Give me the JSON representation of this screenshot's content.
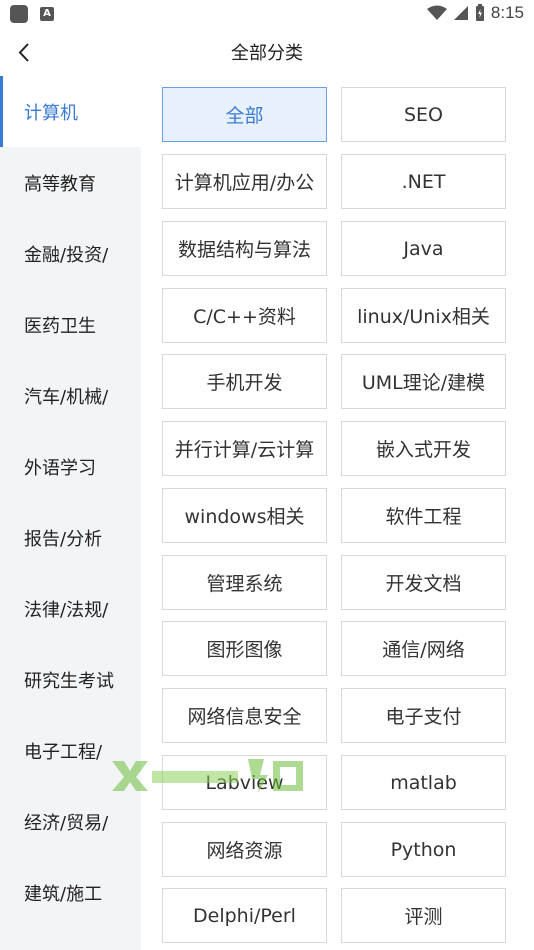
{
  "status": {
    "time": "8:15"
  },
  "header": {
    "title": "全部分类"
  },
  "sidebar": {
    "items": [
      {
        "label": "计算机",
        "active": true
      },
      {
        "label": "高等教育"
      },
      {
        "label": "金融/投资/"
      },
      {
        "label": "医药卫生"
      },
      {
        "label": "汽车/机械/"
      },
      {
        "label": "外语学习"
      },
      {
        "label": "报告/分析"
      },
      {
        "label": "法律/法规/"
      },
      {
        "label": "研究生考试"
      },
      {
        "label": "电子工程/"
      },
      {
        "label": "经济/贸易/"
      },
      {
        "label": "建筑/施工"
      }
    ]
  },
  "categories": [
    {
      "label": "全部",
      "active": true
    },
    {
      "label": "SEO"
    },
    {
      "label": "计算机应用/办公"
    },
    {
      "label": ".NET"
    },
    {
      "label": "数据结构与算法"
    },
    {
      "label": "Java"
    },
    {
      "label": "C/C++资料"
    },
    {
      "label": "linux/Unix相关"
    },
    {
      "label": "手机开发"
    },
    {
      "label": "UML理论/建模"
    },
    {
      "label": "并行计算/云计算"
    },
    {
      "label": "嵌入式开发"
    },
    {
      "label": "windows相关"
    },
    {
      "label": "软件工程"
    },
    {
      "label": "管理系统"
    },
    {
      "label": "开发文档"
    },
    {
      "label": "图形图像"
    },
    {
      "label": "通信/网络"
    },
    {
      "label": "网络信息安全"
    },
    {
      "label": "电子支付"
    },
    {
      "label": "Labview"
    },
    {
      "label": "matlab"
    },
    {
      "label": "网络资源"
    },
    {
      "label": "Python"
    },
    {
      "label": "Delphi/Perl"
    },
    {
      "label": "评测"
    }
  ],
  "colors": {
    "accent": "#3a7bd5",
    "sidebar_bg": "#f3f4f6",
    "active_bg": "#e8f0fb"
  }
}
